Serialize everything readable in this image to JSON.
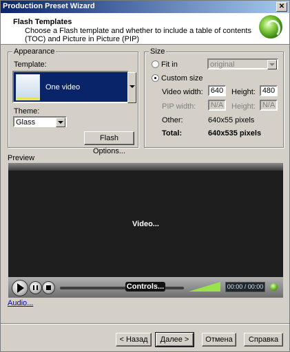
{
  "window": {
    "title": "Production Preset Wizard",
    "close_glyph": "✕"
  },
  "header": {
    "title": "Flash Templates",
    "description": "Choose a Flash template and whether to include a table of contents (TOC) and Picture in Picture (PIP)"
  },
  "appearance": {
    "group_label": "Appearance",
    "template_label": "Template:",
    "template_value": "One video",
    "theme_label": "Theme:",
    "theme_value": "Glass",
    "flash_options_button": "Flash Options..."
  },
  "size": {
    "group_label": "Size",
    "fit_in_label": "Fit in",
    "fit_in_value": "original",
    "custom_size_label": "Custom size",
    "video_width_label": "Video width:",
    "video_width_value": "640",
    "video_height_label": "Height:",
    "video_height_value": "480",
    "pip_width_label": "PIP width:",
    "pip_width_value": "N/A",
    "pip_height_label": "Height:",
    "pip_height_value": "N/A",
    "other_label": "Other:",
    "other_value": "640x55 pixels",
    "total_label": "Total:",
    "total_value": "640x535 pixels",
    "selected": "custom"
  },
  "preview": {
    "label": "Preview",
    "video_text": "Video...",
    "controls_text": "Controls...",
    "time_text": "00:00 / 00:00"
  },
  "audio_link": "Audio...",
  "footer": {
    "back_button": "< Назад",
    "next_button": "Далее >",
    "cancel_button": "Отмена",
    "help_button": "Справка"
  }
}
